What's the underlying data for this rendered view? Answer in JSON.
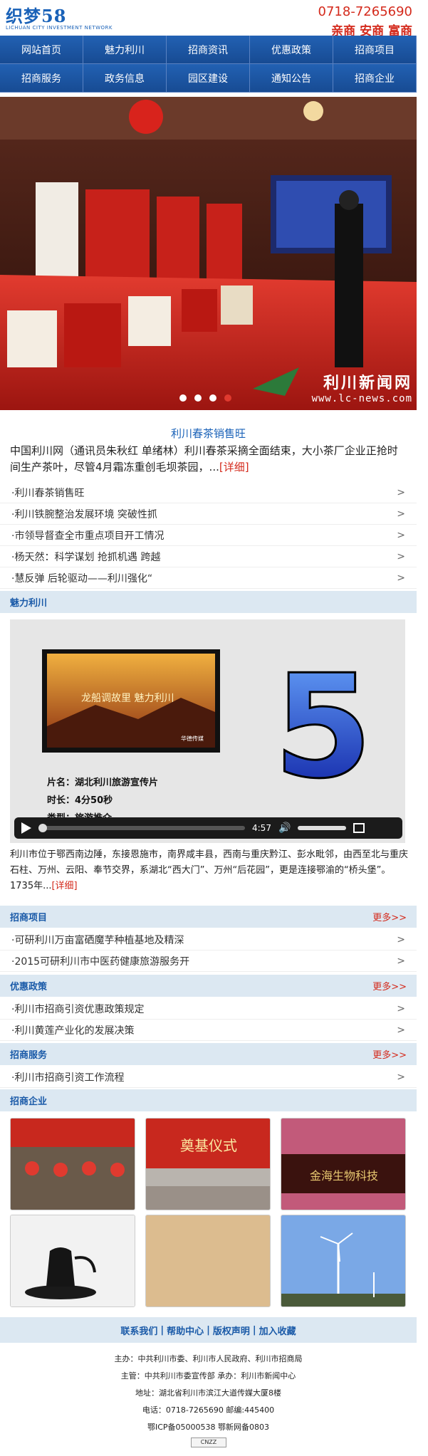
{
  "header": {
    "logo": "织梦58",
    "logo_sub": "LICHUAN CITY INVESTMENT NETWORK",
    "phone": "0718-7265690",
    "slogan": "亲商 安商 富商"
  },
  "nav": [
    "网站首页",
    "魅力利川",
    "招商资讯",
    "优惠政策",
    "招商项目",
    "招商服务",
    "政务信息",
    "园区建设",
    "通知公告",
    "招商企业"
  ],
  "banner": {
    "watermark_cn": "利川新闻网",
    "watermark_url": "www.lc-news.com",
    "slides": 4,
    "active_slide": 4
  },
  "headline": {
    "title": "利川春茶销售旺",
    "text": "中国利川网（通讯员朱秋红 单绪林）利川春茶采摘全面结束，大小茶厂企业正抢时间生产茶叶，尽管4月霜冻重创毛坝茶园，...",
    "more": "[详细]"
  },
  "news": [
    "·利川春茶销售旺",
    "·利川铁腕整治发展环境 突破性抓",
    "·市领导督查全市重点项目开工情况",
    "·杨天然：科学谋划 抢抓机遇 跨越",
    "·慧反弹 后轮驱动——利川强化“"
  ],
  "sections": {
    "charm": "魅力利川",
    "projects": "招商项目",
    "policy": "优惠政策",
    "service": "招商服务",
    "enterprise": "招商企业",
    "more": "更多>>"
  },
  "video": {
    "big_number": "5",
    "name_label": "片名：湖北利川旅游宣传片",
    "duration_label": "时长：4分50秒",
    "type_label": "类型：旅游推介",
    "time": "4:57",
    "thumb_caption": "龙船调故里 魅力利川",
    "thumb_brand": "华德传媒"
  },
  "intro": {
    "text": "利川市位于鄂西南边陲，东接恩施市，南界咸丰县，西南与重庆黔江、彭水毗邻，由西至北与重庆石柱、万州、云阳、奉节交界，系湖北“西大门”、万州“后花园”，更是连接鄂渝的“桥头堡”。1735年...",
    "more": "[详细]"
  },
  "projects": [
    "·可研利川万亩富硒魔芋种植基地及精深",
    "·2015可研利川市中医药健康旅游服务开"
  ],
  "policies": [
    "·利川市招商引资优惠政策规定",
    "·利川黄莲产业化的发展决策"
  ],
  "services": [
    "·利川市招商引资工作流程"
  ],
  "enterprises": {
    "banner2_title": "奠基仪式",
    "banner3_title": "金海生物科技"
  },
  "footer": {
    "links": [
      "联系我们",
      "帮助中心",
      "版权声明",
      "加入收藏"
    ],
    "lines": [
      "主办：中共利川市委、利川市人民政府、利川市招商局",
      "主管：中共利川市委宣传部 承办：利川市新闻中心",
      "地址：湖北省利川市滨江大道传媒大厦8楼",
      "电话：0718-7265690 邮编:445400",
      "鄂ICP备05000538 鄂新网备0803"
    ],
    "badge": "CNZZ"
  },
  "colors": {
    "brand_blue": "#1a62b8",
    "nav_blue": "#1b4f9a",
    "accent_red": "#d42a1c",
    "section_bg": "#dce8f2"
  }
}
